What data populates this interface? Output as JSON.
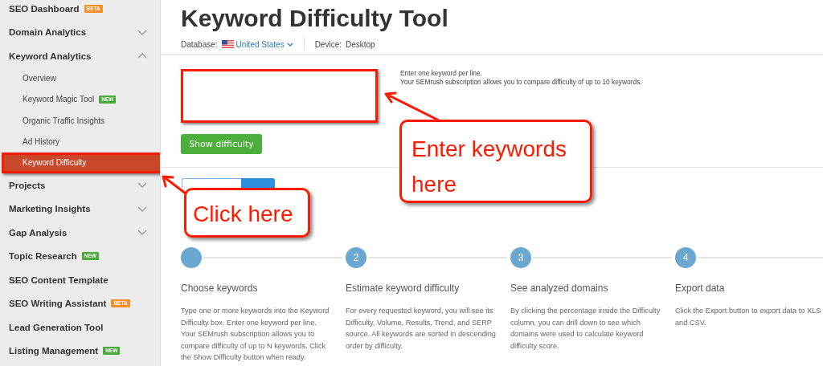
{
  "sidebar": {
    "items": [
      {
        "label": "SEO Dashboard",
        "selected": false,
        "badge": {
          "text": "BETA",
          "kind": "beta"
        }
      },
      {
        "label": "Domain Analytics",
        "selected": false,
        "expanded": false
      },
      {
        "label": "Keyword Analytics",
        "selected": false,
        "expanded": true,
        "children": [
          {
            "label": "Overview",
            "selected": false
          },
          {
            "label": "Keyword Magic Tool",
            "selected": false,
            "badge": {
              "text": "NEW",
              "kind": "new"
            }
          },
          {
            "label": "Organic Traffic Insights",
            "selected": false
          },
          {
            "label": "Ad History",
            "selected": false
          },
          {
            "label": "Keyword Difficulty",
            "selected": true
          }
        ]
      },
      {
        "label": "Projects",
        "selected": false,
        "expanded": false
      },
      {
        "label": "Marketing Insights",
        "selected": false,
        "expanded": false
      },
      {
        "label": "Gap Analysis",
        "selected": false,
        "expanded": false
      },
      {
        "label": "Topic Research",
        "selected": false,
        "badge": {
          "text": "NEW",
          "kind": "new"
        }
      },
      {
        "label": "SEO Content Template",
        "selected": false
      },
      {
        "label": "SEO Writing Assistant",
        "selected": false,
        "badge": {
          "text": "BETA",
          "kind": "beta"
        }
      },
      {
        "label": "Lead Generation Tool",
        "selected": false
      },
      {
        "label": "Listing Management",
        "selected": false,
        "badge": {
          "text": "NEW",
          "kind": "new"
        }
      }
    ]
  },
  "page": {
    "title": "Keyword Difficulty Tool",
    "database_label": "Database:",
    "database_value": "United States",
    "device_label": "Device:",
    "device_value": "Desktop"
  },
  "keyword_input": {
    "highlighted": true
  },
  "hints": [
    "Enter one keyword per line.",
    "Your SEMrush subscription allows you to compare difficulty of up to 10 keywords."
  ],
  "show_button": "Show difficulty",
  "view_switch": [
    {
      "selected": false
    },
    {
      "selected": true
    }
  ],
  "steps": [
    {
      "title": "Choose keywords",
      "text": "Type one or more keywords into the Keyword Difficulty box. Enter one keyword per line. Your SEMrush subscription allows you to compare difficulty of up to N keywords. Click the Show Difficulty button when ready."
    },
    {
      "number": "2",
      "title": "Estimate keyword difficulty",
      "text": "For every requested keyword, you will see its Difficulty, Volume, Results, Trend, and SERP source. All keywords are sorted in descending order by difficulty."
    },
    {
      "number": "3",
      "title": "See analyzed domains",
      "text": "By clicking the percentage inside the Difficulty column, you can drill down to see which domains were used to calculate keyword difficulty score."
    },
    {
      "number": "4",
      "title": "Export data",
      "text": "Click the Export button to export data to XLS and CSV."
    }
  ],
  "annotations": [
    {
      "kind": "keywords",
      "text": "Enter keywords here"
    },
    {
      "kind": "click",
      "text": "Click here"
    }
  ]
}
